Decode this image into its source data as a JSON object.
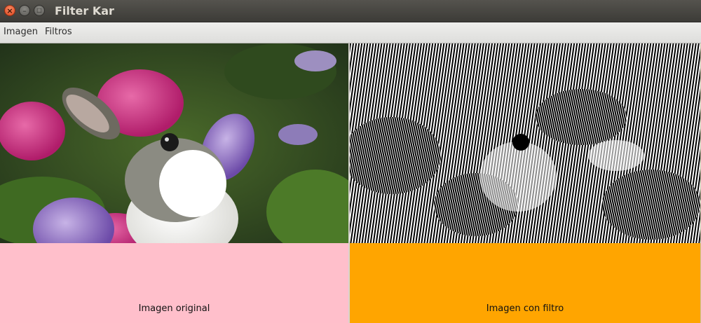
{
  "window": {
    "title": "Filter Kar",
    "close_glyph": "×",
    "min_glyph": "–",
    "max_glyph": "□"
  },
  "menu": {
    "items": [
      "Imagen",
      "Filtros"
    ]
  },
  "panels": {
    "original": {
      "label": "Imagen original",
      "bg": "#ffbfcb"
    },
    "filtered": {
      "label": "Imagen con filtro",
      "bg": "#ffa500"
    }
  },
  "colors": {
    "titlebar": "#3c3b37",
    "close": "#e0461f",
    "title_text": "#dfdbd2"
  }
}
